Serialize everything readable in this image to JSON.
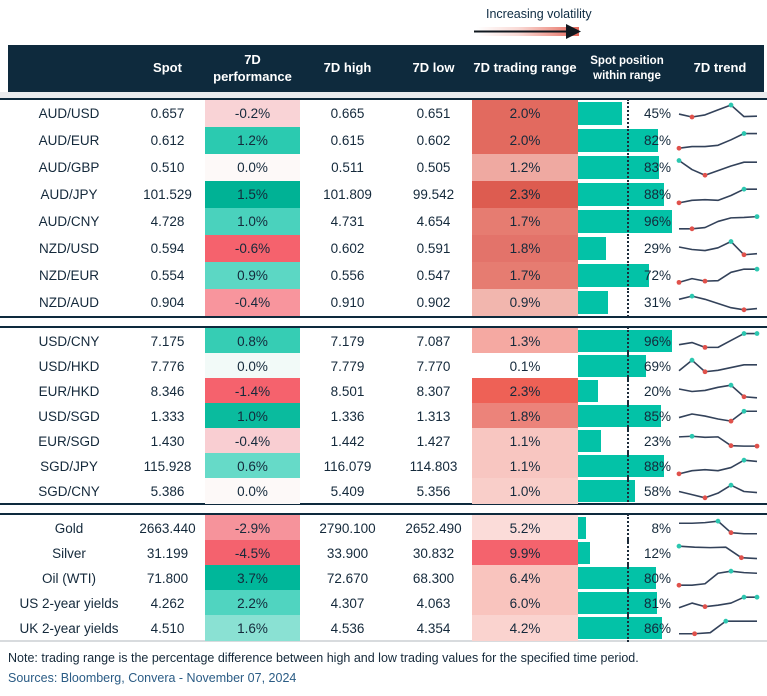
{
  "legend": {
    "label": "Increasing volatility"
  },
  "colors": {
    "header_bg": "#0e2a3d",
    "text": "#14293b",
    "position_bar": "#03c2a7",
    "spark_line": "#33425a",
    "dot_red": "#e0514b",
    "dot_teal": "#2cc7b0"
  },
  "chart_data": {
    "type": "table",
    "columns": [
      "",
      "Spot",
      "7D performance",
      "7D high",
      "7D low",
      "7D trading range",
      "Spot position within range",
      "7D trend"
    ],
    "groups": [
      {
        "rows": [
          {
            "label": "AUD/USD",
            "spot": "0.657",
            "perf": "-0.2%",
            "perf_bg": "#f9d3d6",
            "high": "0.665",
            "low": "0.651",
            "range": "2.0%",
            "range_bg": "#e26a5f",
            "pos": 45,
            "pos_label": "45%",
            "spark": {
              "pts": [
                52,
                38,
                48,
                72,
                95,
                40,
                42
              ],
              "dots": [
                {
                  "i": 1,
                  "c": "r"
                },
                {
                  "i": 4,
                  "c": "t"
                }
              ]
            }
          },
          {
            "label": "AUD/EUR",
            "spot": "0.612",
            "perf": "1.2%",
            "perf_bg": "#2bcab0",
            "high": "0.615",
            "low": "0.602",
            "range": "2.0%",
            "range_bg": "#e26a5f",
            "pos": 82,
            "pos_label": "82%",
            "spark": {
              "pts": [
                18,
                26,
                26,
                32,
                58,
                88,
                88
              ],
              "dots": [
                {
                  "i": 0,
                  "c": "r"
                },
                {
                  "i": 5,
                  "c": "t"
                }
              ]
            }
          },
          {
            "label": "AUD/GBP",
            "spot": "0.510",
            "perf": "0.0%",
            "perf_bg": "#fdf9f8",
            "high": "0.511",
            "low": "0.505",
            "range": "1.2%",
            "range_bg": "#efa9a1",
            "pos": 83,
            "pos_label": "83%",
            "spark": {
              "pts": [
                88,
                45,
                18,
                40,
                62,
                80,
                80
              ],
              "dots": [
                {
                  "i": 0,
                  "c": "t"
                },
                {
                  "i": 2,
                  "c": "r"
                }
              ]
            }
          },
          {
            "label": "AUD/JPY",
            "spot": "101.529",
            "perf": "1.5%",
            "perf_bg": "#00b295",
            "high": "101.809",
            "low": "99.542",
            "range": "2.3%",
            "range_bg": "#dd5c50",
            "pos": 88,
            "pos_label": "88%",
            "spark": {
              "pts": [
                15,
                27,
                30,
                27,
                50,
                80,
                80
              ],
              "dots": [
                {
                  "i": 0,
                  "c": "r"
                },
                {
                  "i": 5,
                  "c": "t"
                }
              ]
            }
          },
          {
            "label": "AUD/CNY",
            "spot": "4.728",
            "perf": "1.0%",
            "perf_bg": "#4ad2bd",
            "high": "4.731",
            "low": "4.654",
            "range": "1.7%",
            "range_bg": "#e67c71",
            "pos": 96,
            "pos_label": "96%",
            "spark": {
              "pts": [
                20,
                20,
                26,
                55,
                72,
                74,
                78
              ],
              "dots": [
                {
                  "i": 1,
                  "c": "r"
                },
                {
                  "i": 6,
                  "c": "t"
                }
              ]
            }
          },
          {
            "label": "NZD/USD",
            "spot": "0.594",
            "perf": "-0.6%",
            "perf_bg": "#f5626d",
            "high": "0.602",
            "low": "0.591",
            "range": "1.8%",
            "range_bg": "#e3736a",
            "pos": 29,
            "pos_label": "29%",
            "spark": {
              "pts": [
                62,
                50,
                45,
                58,
                88,
                25,
                30
              ],
              "dots": [
                {
                  "i": 4,
                  "c": "t"
                },
                {
                  "i": 5,
                  "c": "r"
                }
              ]
            }
          },
          {
            "label": "NZD/EUR",
            "spot": "0.554",
            "perf": "0.9%",
            "perf_bg": "#5cd7c4",
            "high": "0.556",
            "low": "0.547",
            "range": "1.7%",
            "range_bg": "#e67c71",
            "pos": 72,
            "pos_label": "72%",
            "spark": {
              "pts": [
                22,
                40,
                28,
                30,
                70,
                85,
                85
              ],
              "dots": [
                {
                  "i": 0,
                  "c": "r"
                },
                {
                  "i": 2,
                  "c": "r"
                },
                {
                  "i": 6,
                  "c": "t"
                }
              ]
            }
          },
          {
            "label": "NZD/AUD",
            "spot": "0.904",
            "perf": "-0.4%",
            "perf_bg": "#f8959d",
            "high": "0.910",
            "low": "0.902",
            "range": "0.9%",
            "range_bg": "#f2b6ae",
            "pos": 31,
            "pos_label": "31%",
            "spark": {
              "pts": [
                70,
                85,
                70,
                50,
                30,
                20,
                26
              ],
              "dots": [
                {
                  "i": 1,
                  "c": "t"
                },
                {
                  "i": 5,
                  "c": "r"
                }
              ]
            }
          }
        ]
      },
      {
        "rows": [
          {
            "label": "USD/CNY",
            "spot": "7.175",
            "perf": "0.8%",
            "perf_bg": "#36cdb4",
            "high": "7.179",
            "low": "7.087",
            "range": "1.3%",
            "range_bg": "#f5a9a2",
            "pos": 96,
            "pos_label": "96%",
            "spark": {
              "pts": [
                35,
                45,
                22,
                22,
                55,
                88,
                88
              ],
              "dots": [
                {
                  "i": 2,
                  "c": "r"
                },
                {
                  "i": 5,
                  "c": "t"
                },
                {
                  "i": 6,
                  "c": "t"
                }
              ]
            }
          },
          {
            "label": "USD/HKD",
            "spot": "7.776",
            "perf": "0.0%",
            "perf_bg": "#f2faf8",
            "high": "7.779",
            "low": "7.770",
            "range": "0.1%",
            "range_bg": "#ffffff",
            "pos": 69,
            "pos_label": "69%",
            "spark": {
              "pts": [
                30,
                80,
                25,
                32,
                45,
                58,
                58
              ],
              "dots": [
                {
                  "i": 1,
                  "c": "t"
                },
                {
                  "i": 2,
                  "c": "r"
                }
              ]
            }
          },
          {
            "label": "EUR/HKD",
            "spot": "8.346",
            "perf": "-1.4%",
            "perf_bg": "#f5626d",
            "high": "8.501",
            "low": "8.307",
            "range": "2.3%",
            "range_bg": "#ee6156",
            "pos": 20,
            "pos_label": "20%",
            "spark": {
              "pts": [
                62,
                50,
                55,
                70,
                80,
                25,
                20
              ],
              "dots": [
                {
                  "i": 4,
                  "c": "t"
                },
                {
                  "i": 5,
                  "c": "r"
                }
              ]
            }
          },
          {
            "label": "USD/SGD",
            "spot": "1.333",
            "perf": "1.0%",
            "perf_bg": "#0abb9e",
            "high": "1.336",
            "low": "1.313",
            "range": "1.8%",
            "range_bg": "#ec837a",
            "pos": 85,
            "pos_label": "85%",
            "spark": {
              "pts": [
                45,
                62,
                52,
                38,
                28,
                75,
                75
              ],
              "dots": [
                {
                  "i": 4,
                  "c": "r"
                },
                {
                  "i": 5,
                  "c": "t"
                }
              ]
            }
          },
          {
            "label": "EUR/SGD",
            "spot": "1.430",
            "perf": "-0.4%",
            "perf_bg": "#f9ced2",
            "high": "1.442",
            "low": "1.427",
            "range": "1.1%",
            "range_bg": "#f8c6c1",
            "pos": 23,
            "pos_label": "23%",
            "spark": {
              "pts": [
                72,
                75,
                70,
                72,
                30,
                28,
                28
              ],
              "dots": [
                {
                  "i": 1,
                  "c": "t"
                },
                {
                  "i": 4,
                  "c": "r"
                },
                {
                  "i": 6,
                  "c": "r"
                }
              ]
            }
          },
          {
            "label": "SGD/JPY",
            "spot": "115.928",
            "perf": "0.6%",
            "perf_bg": "#66dac8",
            "high": "116.079",
            "low": "114.803",
            "range": "1.1%",
            "range_bg": "#f8c6c1",
            "pos": 88,
            "pos_label": "88%",
            "spark": {
              "pts": [
                15,
                30,
                35,
                30,
                45,
                80,
                74
              ],
              "dots": [
                {
                  "i": 0,
                  "c": "r"
                },
                {
                  "i": 5,
                  "c": "t"
                }
              ]
            }
          },
          {
            "label": "SGD/CNY",
            "spot": "5.386",
            "perf": "0.0%",
            "perf_bg": "#fdf9f8",
            "high": "5.409",
            "low": "5.356",
            "range": "1.0%",
            "range_bg": "#f9cec9",
            "pos": 58,
            "pos_label": "58%",
            "spark": {
              "pts": [
                50,
                35,
                20,
                42,
                80,
                50,
                45
              ],
              "dots": [
                {
                  "i": 2,
                  "c": "r"
                },
                {
                  "i": 4,
                  "c": "t"
                }
              ]
            }
          }
        ]
      },
      {
        "rows": [
          {
            "label": "Gold",
            "spot": "2663.440",
            "perf": "-2.9%",
            "perf_bg": "#f6939b",
            "high": "2790.100",
            "low": "2652.490",
            "range": "5.2%",
            "range_bg": "#fbdcd9",
            "pos": 8,
            "pos_label": "8%",
            "spark": {
              "pts": [
                75,
                75,
                78,
                85,
                30,
                25,
                25
              ],
              "dots": [
                {
                  "i": 3,
                  "c": "t"
                },
                {
                  "i": 4,
                  "c": "r"
                }
              ]
            }
          },
          {
            "label": "Silver",
            "spot": "31.199",
            "perf": "-4.5%",
            "perf_bg": "#f4626e",
            "high": "33.900",
            "low": "30.832",
            "range": "9.9%",
            "range_bg": "#f4636d",
            "pos": 12,
            "pos_label": "12%",
            "spark": {
              "pts": [
                85,
                80,
                78,
                80,
                30,
                26
              ],
              "dots": [
                {
                  "i": 0,
                  "c": "t"
                },
                {
                  "i": 4,
                  "c": "r"
                }
              ]
            }
          },
          {
            "label": "Oil (WTI)",
            "spot": "71.800",
            "perf": "3.7%",
            "perf_bg": "#00b79a",
            "high": "72.670",
            "low": "68.300",
            "range": "6.4%",
            "range_bg": "#f9c4be",
            "pos": 80,
            "pos_label": "80%",
            "spark": {
              "pts": [
                18,
                18,
                25,
                75,
                85,
                78,
                75
              ],
              "dots": [
                {
                  "i": 0,
                  "c": "r"
                },
                {
                  "i": 4,
                  "c": "t"
                }
              ]
            }
          },
          {
            "label": "US 2-year yields",
            "spot": "4.262",
            "perf": "2.2%",
            "perf_bg": "#50d4c0",
            "high": "4.307",
            "low": "4.063",
            "range": "6.0%",
            "range_bg": "#f9c4be",
            "pos": 81,
            "pos_label": "81%",
            "spark": {
              "pts": [
                30,
                52,
                35,
                42,
                52,
                80,
                80
              ],
              "dots": [
                {
                  "i": 2,
                  "c": "r"
                },
                {
                  "i": 5,
                  "c": "t"
                },
                {
                  "i": 6,
                  "c": "t"
                }
              ]
            }
          },
          {
            "label": "UK 2-year yields",
            "spot": "4.510",
            "perf": "1.6%",
            "perf_bg": "#8ae1d3",
            "high": "4.536",
            "low": "4.354",
            "range": "4.2%",
            "range_bg": "#fad3cf",
            "pos": 86,
            "pos_label": "86%",
            "spark": {
              "pts": [
                25,
                25,
                30,
                85,
                85,
                85
              ],
              "dots": [
                {
                  "i": 1,
                  "c": "r"
                },
                {
                  "i": 3,
                  "c": "t"
                }
              ]
            }
          }
        ]
      }
    ]
  },
  "footer": {
    "note": "Note: trading range is the percentage difference between high and low trading values for the specified time period.",
    "sources": "Sources: Bloomberg, Convera - November 07, 2024"
  }
}
